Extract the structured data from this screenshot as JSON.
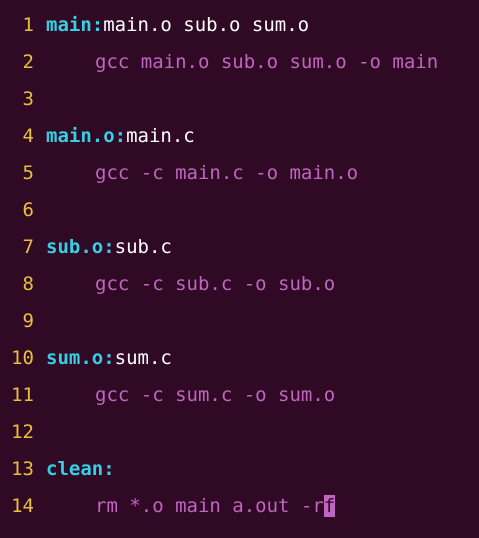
{
  "editor": {
    "colors": {
      "background": "#300a24",
      "line_number": "#e8c13c",
      "target": "#34d0e6",
      "dependencies": "#ffffff",
      "command": "#c065c0",
      "cursor": "#c065c0"
    },
    "lines": [
      {
        "num": "1",
        "target": "main:",
        "deps": "main.o sub.o sum.o"
      },
      {
        "num": "2",
        "cmd": "gcc main.o sub.o sum.o -o main"
      },
      {
        "num": "3"
      },
      {
        "num": "4",
        "target": "main.o:",
        "deps": "main.c"
      },
      {
        "num": "5",
        "cmd": "gcc -c main.c -o main.o"
      },
      {
        "num": "6"
      },
      {
        "num": "7",
        "target": "sub.o:",
        "deps": "sub.c"
      },
      {
        "num": "8",
        "cmd": "gcc -c sub.c -o sub.o"
      },
      {
        "num": "9"
      },
      {
        "num": "10",
        "target": "sum.o:",
        "deps": "sum.c"
      },
      {
        "num": "11",
        "cmd": "gcc -c sum.c -o sum.o"
      },
      {
        "num": "12"
      },
      {
        "num": "13",
        "target": "clean:"
      },
      {
        "num": "14",
        "cmd_before_cursor": "rm *.o main a.out -r",
        "cursor_char": "f"
      }
    ]
  }
}
